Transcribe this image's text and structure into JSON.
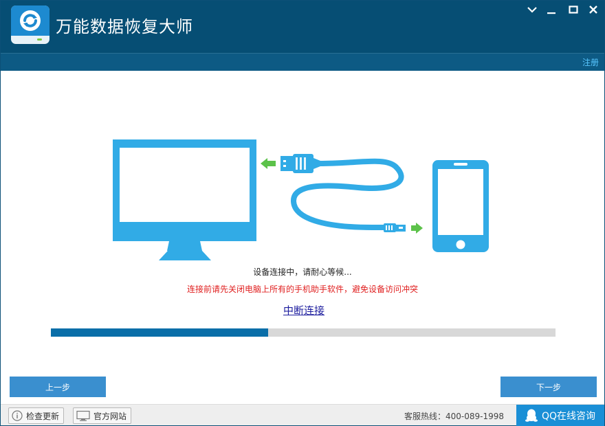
{
  "app": {
    "title": "万能数据恢复大师"
  },
  "window_controls": [
    "minimize-dropdown",
    "minimize",
    "maximize",
    "close"
  ],
  "subbar": {
    "register_label": "注册"
  },
  "main": {
    "status": "设备连接中，请耐心等候...",
    "warning": "连接前请先关闭电脑上所有的手机助手软件，避免设备访问冲突",
    "disconnect_label": "中断连接",
    "progress_fraction": 0.43
  },
  "nav": {
    "prev_label": "上一步",
    "next_label": "下一步"
  },
  "footer": {
    "check_update_label": "检查更新",
    "official_site_label": "官方网站",
    "hotline": "客服热线：400-089-1998",
    "qq_label": "QQ在线咨询"
  },
  "colors": {
    "titlebar": "#064e74",
    "accent": "#31abe6",
    "arrow_green": "#5cc24a",
    "warning": "#e02020",
    "button": "#3a8fcf",
    "progress": "#0a6ea8"
  }
}
